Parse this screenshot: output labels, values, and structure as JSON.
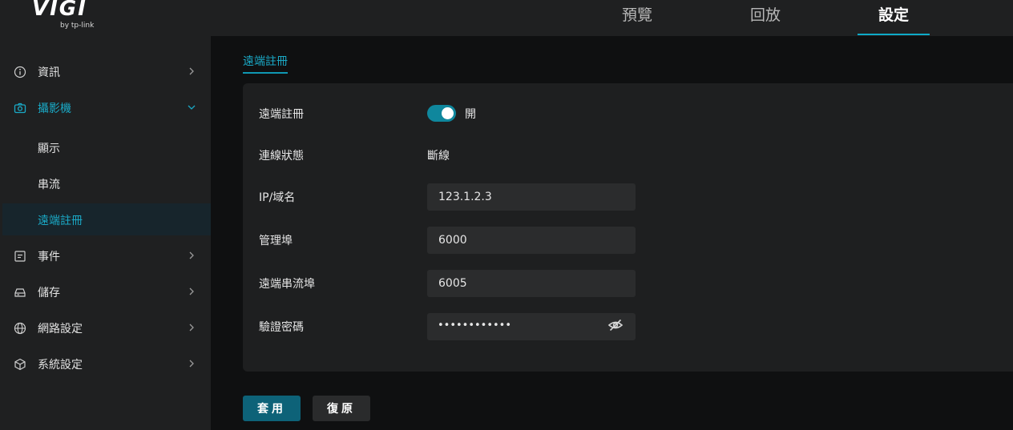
{
  "brand": {
    "logo": "VIGI",
    "sub": "by tp-link"
  },
  "topnav": [
    {
      "label": "預覽",
      "active": false
    },
    {
      "label": "回放",
      "active": false
    },
    {
      "label": "設定",
      "active": true
    }
  ],
  "sidebar": {
    "items": [
      {
        "label": "資訊",
        "icon": "info-icon"
      },
      {
        "label": "攝影機",
        "icon": "camera-icon",
        "expanded": true
      },
      {
        "label": "事件",
        "icon": "event-icon"
      },
      {
        "label": "儲存",
        "icon": "storage-icon"
      },
      {
        "label": "網路設定",
        "icon": "globe-icon"
      },
      {
        "label": "系統設定",
        "icon": "cube-icon"
      }
    ],
    "subitems": [
      {
        "label": "顯示"
      },
      {
        "label": "串流"
      },
      {
        "label": "遠端註冊",
        "active": true
      }
    ]
  },
  "main": {
    "tab": "遠端註冊",
    "form": {
      "remote_reg_label": "遠端註冊",
      "remote_reg_state": "開",
      "status_label": "連線狀態",
      "status_value": "斷線",
      "ip_label": "IP/域名",
      "ip_value": "123.1.2.3",
      "mgmt_port_label": "管理埠",
      "mgmt_port_value": "6000",
      "stream_port_label": "遠端串流埠",
      "stream_port_value": "6005",
      "password_label": "驗證密碼",
      "password_mask": "••••••••••••"
    },
    "buttons": {
      "apply": "套用",
      "reset": "復原"
    }
  },
  "colors": {
    "accent": "#1aa9c6",
    "apply_bg": "#0d6278",
    "toggle_on": "#0f879d"
  }
}
